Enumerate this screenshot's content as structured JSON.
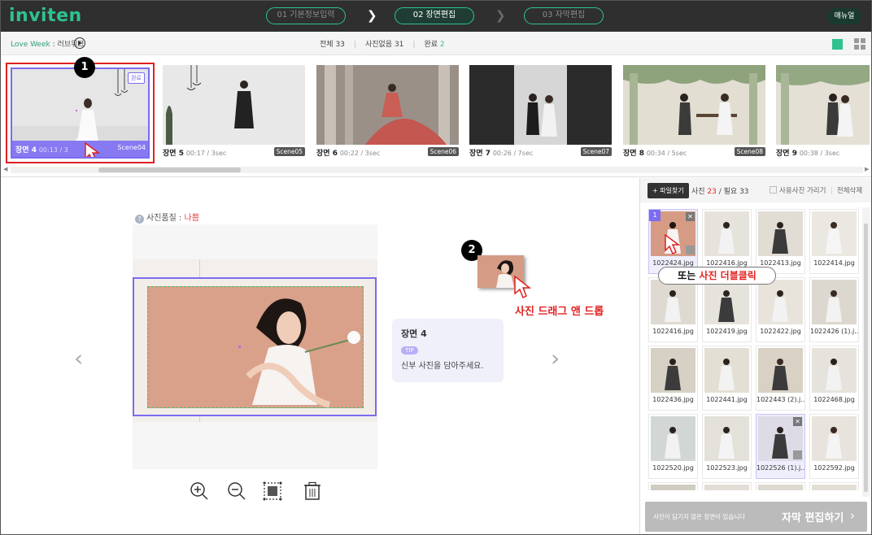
{
  "app": {
    "logo": "inviten",
    "manual_label": "매뉴얼"
  },
  "steps": [
    {
      "num": "01",
      "label": "기본정보입력",
      "active": false
    },
    {
      "num": "02",
      "label": "장면편집",
      "active": true
    },
    {
      "num": "03",
      "label": "자막편집",
      "active": false
    }
  ],
  "subbar": {
    "project_title": "Love Week",
    "project_sep": " : ",
    "project_sub": "러브위크",
    "total_label": "전체",
    "total_value": "33",
    "no_photo_label": "사진없음",
    "no_photo_value": "31",
    "done_label": "완료",
    "done_value": "2"
  },
  "scenes": [
    {
      "name": "장면 4",
      "time": "00:13 / 3",
      "tag": "Scene04",
      "done_badge": "완료"
    },
    {
      "name": "장면 5",
      "time": "00:17 / 3sec",
      "tag": "Scene05"
    },
    {
      "name": "장면 6",
      "time": "00:22 / 3sec",
      "tag": "Scene06"
    },
    {
      "name": "장면 7",
      "time": "00:26 / 7sec",
      "tag": "Scene07"
    },
    {
      "name": "장면 8",
      "time": "00:34 / 5sec",
      "tag": "Scene08"
    },
    {
      "name": "장면 9",
      "time": "00:38 / 3sec",
      "tag": ""
    }
  ],
  "editor": {
    "quality_label": "사진품질 : ",
    "quality_value": "나쁨",
    "tooltip_title": "장면 4",
    "tooltip_tag": "TIP",
    "tooltip_desc": "신부 사진을 담아주세요.",
    "drag_label": "사진 드래그 앤 드롭"
  },
  "callouts": {
    "one": "1",
    "two": "2"
  },
  "panel": {
    "find_button": "+ 파일찾기",
    "photo_label": "사진 ",
    "photo_used": "23",
    "photo_sep": " / 필요 ",
    "photo_needed": "33",
    "hide_used_label": "사용사진 가리기",
    "delete_all_label": "전체삭제",
    "dbl_click_prefix": "또는 ",
    "dbl_click_red": "사진 더블클릭",
    "files": [
      "1022424.jpg",
      "1022416.jpg",
      "1022413.jpg",
      "1022414.jpg",
      "1022416.jpg",
      "1022419.jpg",
      "1022422.jpg",
      "1022426 (1).j...",
      "1022436.jpg",
      "1022441.jpg",
      "1022443 (2).j...",
      "1022468.jpg",
      "1022520.jpg",
      "1022523.jpg",
      "1022526 (1).j...",
      "1022592.jpg",
      "",
      "",
      "",
      ""
    ],
    "selected_badge": "1",
    "edit_note": "사진이 담기지 않은 장면이 있습니다",
    "edit_button": "자막 편집하기"
  },
  "colors": {
    "brand": "#2ec28e",
    "accent": "#7b6cf0",
    "alert": "#e22222"
  }
}
